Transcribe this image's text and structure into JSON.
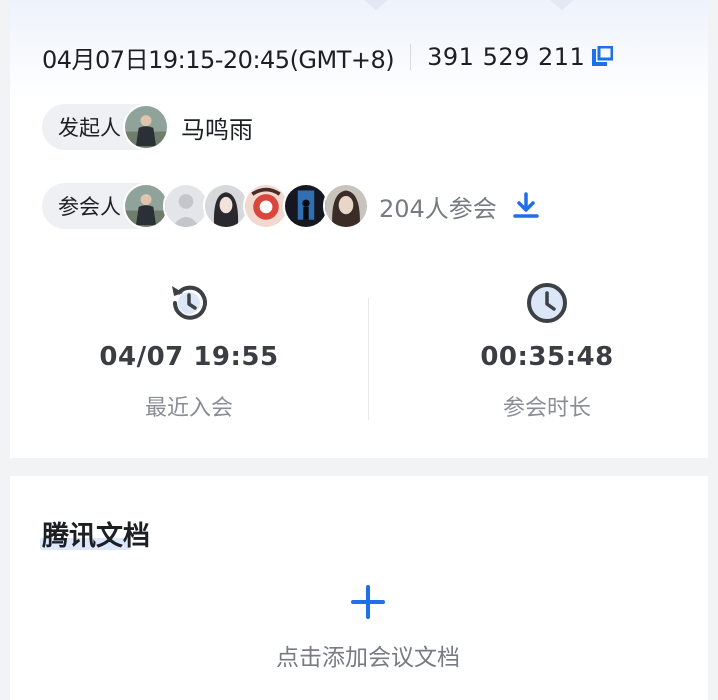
{
  "meeting": {
    "time_range": "04月07日19:15-20:45(GMT+8)",
    "meeting_id": "391 529 211"
  },
  "host": {
    "label": "发起人",
    "name": "马鸣雨"
  },
  "participants": {
    "label": "参会人",
    "count_text": "204人参会",
    "avatars": [
      "avatar-man-suit",
      "avatar-default-gray",
      "avatar-woman-dark-hair",
      "avatar-illustration-red",
      "avatar-dark-figure",
      "avatar-woman-long-hair"
    ]
  },
  "stats": {
    "last_join": {
      "value": "04/07 19:55",
      "label": "最近入会",
      "icon": "history-clock-icon"
    },
    "duration": {
      "value": "00:35:48",
      "label": "参会时长",
      "icon": "clock-icon"
    }
  },
  "docs": {
    "title": "腾讯文档",
    "add_label": "点击添加会议文档"
  },
  "colors": {
    "accent": "#1e6fe8",
    "text_primary": "#1c1f23",
    "text_secondary": "#777b82",
    "pill_bg": "#eef0f3"
  }
}
